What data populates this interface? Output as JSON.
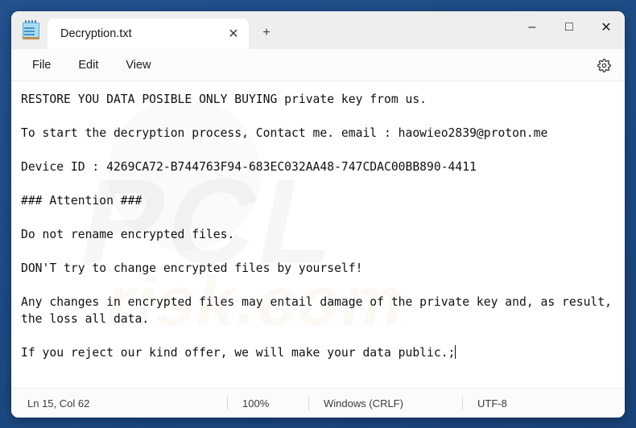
{
  "window": {
    "app_icon": "notepad-icon",
    "controls": {
      "minimize": "–",
      "maximize": "□",
      "close": "✕"
    }
  },
  "tabs": {
    "active": {
      "title": "Decryption.txt",
      "close_glyph": "✕"
    },
    "new_tab_glyph": "+"
  },
  "menu": {
    "items": [
      {
        "label": "File"
      },
      {
        "label": "Edit"
      },
      {
        "label": "View"
      }
    ],
    "settings_icon": "gear-icon"
  },
  "editor": {
    "watermark_text": "PCL",
    "watermark_sub": "risk.com",
    "lines": [
      "RESTORE YOU DATA POSIBLE ONLY BUYING private key from us.",
      "",
      "To start the decryption process, Contact me. email : haowieo2839@proton.me",
      "",
      "Device ID : 4269CA72-B744763F94-683EC032AA48-747CDAC00BB890-4411",
      "",
      "### Attention ###",
      "",
      "Do not rename encrypted files.",
      "",
      "DON'T try to change encrypted files by yourself!",
      "",
      "Any changes in encrypted files may entail damage of the private key and, as result, the loss all data.",
      "",
      "If you reject our kind offer, we will make your data public.;"
    ]
  },
  "statusbar": {
    "position": "Ln 15, Col 62",
    "zoom": "100%",
    "line_ending": "Windows (CRLF)",
    "encoding": "UTF-8"
  }
}
